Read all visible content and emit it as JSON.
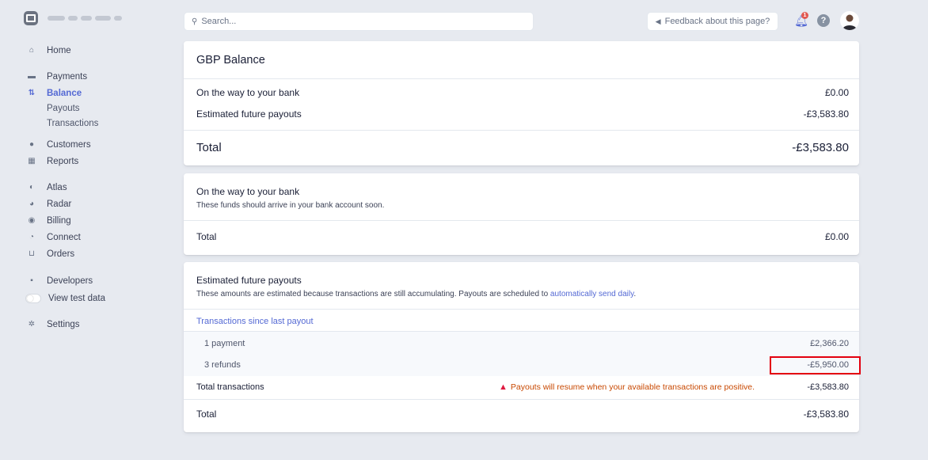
{
  "sidebar": {
    "items": [
      {
        "label": "Home"
      },
      {
        "label": "Payments"
      },
      {
        "label": "Balance"
      },
      {
        "label": "Customers"
      },
      {
        "label": "Reports"
      },
      {
        "label": "Atlas"
      },
      {
        "label": "Radar"
      },
      {
        "label": "Billing"
      },
      {
        "label": "Connect"
      },
      {
        "label": "Orders"
      },
      {
        "label": "Developers"
      },
      {
        "label": "View test data"
      },
      {
        "label": "Settings"
      }
    ],
    "sub_items": [
      {
        "label": "Payouts"
      },
      {
        "label": "Transactions"
      }
    ]
  },
  "topbar": {
    "search_placeholder": "Search...",
    "feedback_label": "Feedback about this page?",
    "notification_badge": "1",
    "help_glyph": "?"
  },
  "balance_card": {
    "title": "GBP Balance",
    "rows": [
      {
        "label": "On the way to your bank",
        "value": "£0.00"
      },
      {
        "label": "Estimated future payouts",
        "value": "-£3,583.80"
      }
    ],
    "total_label": "Total",
    "total_value": "-£3,583.80"
  },
  "bank_card": {
    "title": "On the way to your bank",
    "subtitle": "These funds should arrive in your bank account soon.",
    "total_label": "Total",
    "total_value": "£0.00"
  },
  "future_card": {
    "title": "Estimated future payouts",
    "subtitle_prefix": "These amounts are estimated because transactions are still accumulating. Payouts are scheduled to ",
    "subtitle_link": "automatically send daily",
    "subtitle_suffix": ".",
    "section_link": "Transactions since last payout",
    "lines": [
      {
        "label": "1 payment",
        "value": "£2,366.20"
      },
      {
        "label": "3 refunds",
        "value": "-£5,950.00"
      }
    ],
    "total_transactions_label": "Total transactions",
    "warning": "Payouts will resume when your available transactions are positive.",
    "total_transactions_value": "-£3,583.80",
    "total_label": "Total",
    "total_value": "-£3,583.80"
  },
  "colors": {
    "accent": "#5469d4",
    "warning": "#c84801",
    "highlight": "#e3000f"
  }
}
